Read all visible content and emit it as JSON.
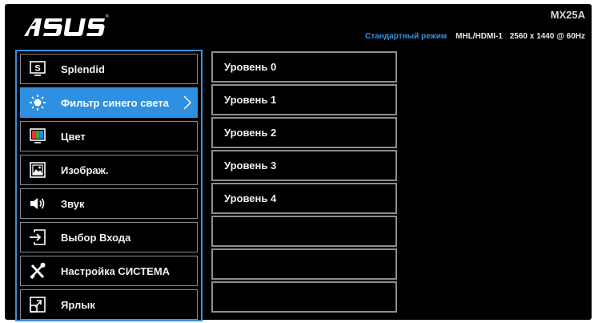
{
  "header": {
    "brand": "ASUS",
    "model": "MX25A",
    "mode": "Стандартный режим",
    "input": "MHL/HDMI-1",
    "resolution": "2560 x 1440 @ 60Hz"
  },
  "menu": {
    "items": [
      {
        "label": "Splendid",
        "icon": "splendid-icon",
        "selected": false
      },
      {
        "label": "Фильтр синего света",
        "icon": "blue-light-icon",
        "selected": true
      },
      {
        "label": "Цвет",
        "icon": "color-icon",
        "selected": false
      },
      {
        "label": "Изображ.",
        "icon": "image-icon",
        "selected": false
      },
      {
        "label": "Звук",
        "icon": "speaker-icon",
        "selected": false
      },
      {
        "label": "Выбор Входа",
        "icon": "input-select-icon",
        "selected": false
      },
      {
        "label": "Настройка СИСТЕМА",
        "icon": "tools-icon",
        "selected": false
      },
      {
        "label": "Ярлык",
        "icon": "shortcut-icon",
        "selected": false
      }
    ]
  },
  "submenu": {
    "items": [
      {
        "label": "Уровень 0"
      },
      {
        "label": "Уровень 1"
      },
      {
        "label": "Уровень 2"
      },
      {
        "label": "Уровень 3"
      },
      {
        "label": "Уровень 4"
      },
      {
        "label": ""
      },
      {
        "label": ""
      },
      {
        "label": ""
      }
    ]
  },
  "colors": {
    "accent": "#2f8fe0",
    "background": "#000000",
    "mode_text": "#3c8fd8"
  }
}
